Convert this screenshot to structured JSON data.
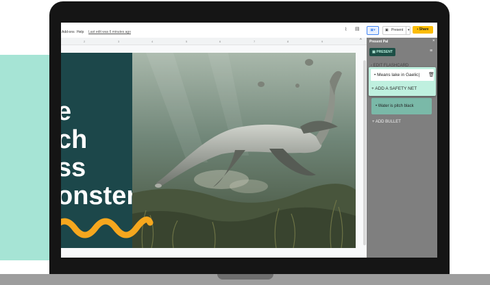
{
  "menubar": {
    "addons": "Add-ons",
    "help": "Help",
    "last_edit": "Last edit was 6 minutes ago"
  },
  "toolbar": {
    "present_label": "Present",
    "share_label": "Share"
  },
  "ruler": {
    "ticks": [
      "2",
      "3",
      "4",
      "5",
      "6",
      "7",
      "8",
      "9"
    ]
  },
  "slide": {
    "title_lines": [
      "e",
      "ch",
      "ss",
      "onster"
    ],
    "colors": {
      "left_panel": "#1c474a",
      "squiggle": "#f6a71e"
    }
  },
  "panel": {
    "title": "Present Pal",
    "present_button": "PRESENT",
    "edit_flashcard": "EDIT FLASHCARD",
    "bullet_input": "Means lake in Gaelic",
    "add_safety_net": "ADD A SAFETY NET",
    "card_bullet": "Water is pitch black",
    "add_bullet": "ADD BULLET",
    "colors": {
      "panel_bg": "#7f7f7f",
      "popup_bg": "#bff0df",
      "card_bg": "#7ab9a8",
      "share_yellow": "#fbbc05"
    }
  }
}
